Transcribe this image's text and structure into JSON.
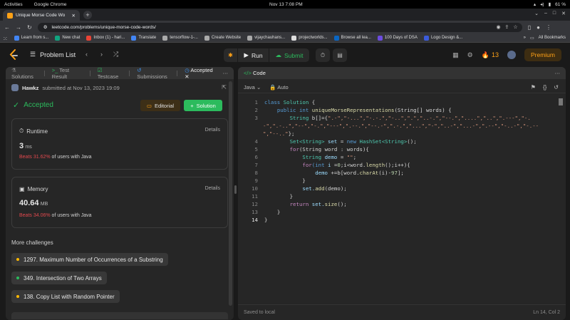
{
  "system": {
    "activities": "Activities",
    "app": "Google Chrome",
    "clock": "Nov 13  7:08 PM",
    "battery": "61 %"
  },
  "browser": {
    "tab_title": "Unique Morse Code Wo",
    "url": "leetcode.com/problems/unique-morse-code-words/",
    "bookmarks": [
      {
        "label": "Learn from s...",
        "color": "#4285f4"
      },
      {
        "label": "New chat",
        "color": "#10a37f"
      },
      {
        "label": "Inbox (1) - hari...",
        "color": "#ea4335"
      },
      {
        "label": "Translate",
        "color": "#4285f4"
      },
      {
        "label": "tensorflow-1-...",
        "color": "#aaaaaa"
      },
      {
        "label": "Create Website",
        "color": "#aaaaaa"
      },
      {
        "label": "vijaychauhans...",
        "color": "#aaaaaa"
      },
      {
        "label": "projectworlds...",
        "color": "#dddddd"
      },
      {
        "label": "Browse all lea...",
        "color": "#0a66c2"
      },
      {
        "label": "100 Days of DSA",
        "color": "#6c4ce0"
      },
      {
        "label": "Logo Design &...",
        "color": "#3b5bdb"
      }
    ],
    "all_bookmarks": "All Bookmarks"
  },
  "nav": {
    "problem_list": "Problem List",
    "run": "Run",
    "submit": "Submit",
    "streak": "13",
    "premium": "Premium"
  },
  "left_tabs": {
    "solutions": "Solutions",
    "test_result": "Test Result",
    "testcase": "Testcase",
    "submissions": "Submissions",
    "accepted": "Accepted"
  },
  "submission": {
    "user": "Hawkz",
    "submitted": "submitted at Nov 13, 2023 19:09",
    "status": "Accepted",
    "editorial": "Editorial",
    "solution": "Solution",
    "runtime": {
      "title": "Runtime",
      "details": "Details",
      "value": "3",
      "unit": "ms",
      "beats": "Beats 31.62%",
      "suffix": "of users with Java"
    },
    "memory": {
      "title": "Memory",
      "details": "Details",
      "value": "40.64",
      "unit": "MB",
      "beats": "Beats 34.06%",
      "suffix": "of users with Java"
    }
  },
  "challenges": {
    "title": "More challenges",
    "items": [
      {
        "label": "1297. Maximum Number of Occurrences of a Substring",
        "color": "#ffb800"
      },
      {
        "label": "349. Intersection of Two Arrays",
        "color": "#2cbb5d"
      },
      {
        "label": "138. Copy List with Random Pointer",
        "color": "#ffb800"
      }
    ]
  },
  "code_panel": {
    "title": "Code",
    "language": "Java",
    "auto": "Auto",
    "saved": "Saved to local",
    "position": "Ln 14, Col 2",
    "line_numbers": [
      "1",
      "2",
      "3",
      "",
      "",
      "4",
      "5",
      "6",
      "7",
      "8",
      "9",
      "10",
      "11",
      "12",
      "13",
      "14"
    ]
  },
  "code_text": {
    "l1a": "class",
    "l1b": "Solution",
    "l1c": "{",
    "l2a": "public",
    "l2b": "int",
    "l2c": "uniqueMorseRepresentations",
    "l2d": "(String[] words) {",
    "l3a": "String",
    "l3b": "b[]={",
    "l3str1": "\".-\",\"-...\",\"-.-.\",\"-..\",\".\",\"..-.\",\"--.\",\"....\",\"..\",\".---\",\"-.",
    "l3str2": "-\",\".-..\",\"--\",\"-.\",\"---\",\".--.\",\"--.-\",\".-.\",\"...\",\"-\",\"..-\",\"...-\",\".--\",\"-..-\",\"-.--",
    "l3str3": "\",\"--..\"",
    "l3end": "};",
    "l4a": "Set<String>",
    "l4b": "set",
    "l4c": "=",
    "l4d": "new",
    "l4e": "HashSet<String>",
    "l4f": "();",
    "l5a": "for",
    "l5b": "(String word : words){",
    "l6a": "String",
    "l6b": "demo",
    "l6c": "=",
    "l6d": "\"\"",
    "l6e": ";",
    "l7a": "for",
    "l7b": "(int",
    "l7c": "i",
    "l7d": "=",
    "l7e": "0",
    "l7f": ";i<word.",
    "l7g": "length",
    "l7h": "();i++){",
    "l8a": "demo",
    "l8b": "+=b[word.",
    "l8c": "charAt",
    "l8d": "(i)-",
    "l8e": "97",
    "l8f": "];",
    "l9": "}",
    "l10a": "set.",
    "l10b": "add",
    "l10c": "(demo);",
    "l11": "}",
    "l12a": "return",
    "l12b": "set.",
    "l12c": "size",
    "l12d": "();",
    "l13": "}",
    "l14": "}"
  }
}
